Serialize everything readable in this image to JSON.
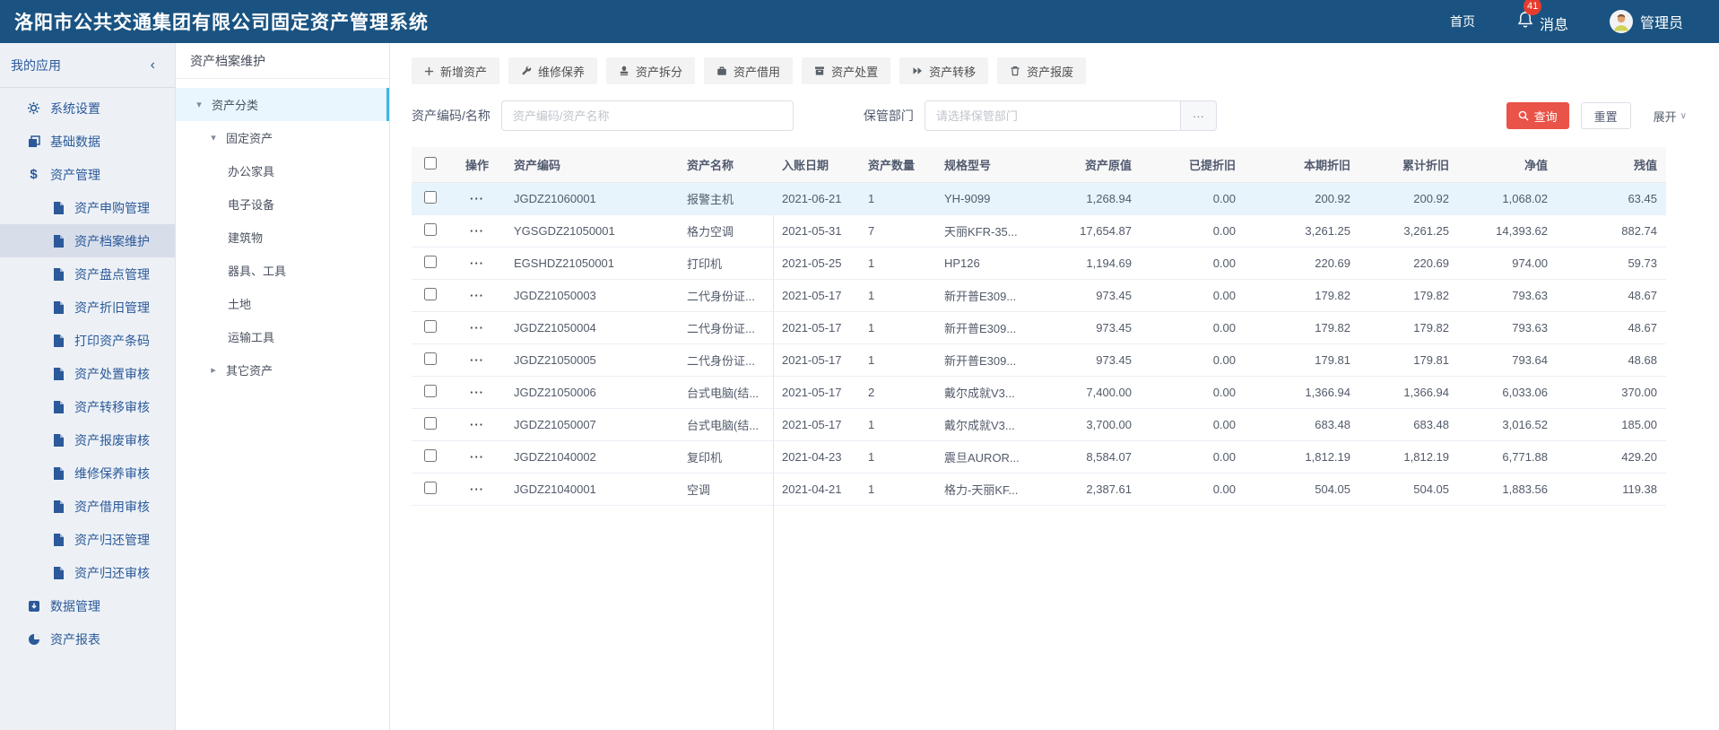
{
  "header": {
    "title": "洛阳市公共交通集团有限公司固定资产管理系统",
    "nav_home": "首页",
    "messages_label": "消息",
    "messages_count": "41",
    "user_label": "管理员"
  },
  "icons": {
    "caret_down": "▾",
    "caret_right": "▸",
    "collapse": "‹",
    "expand_caret": "∨",
    "plus": "+",
    "ellipsis": "···",
    "row_actions": "···"
  },
  "sidebar": {
    "header": "我的应用",
    "items": [
      {
        "label": "系统设置"
      },
      {
        "label": "基础数据"
      },
      {
        "label": "资产管理"
      },
      {
        "label": "资产申购管理"
      },
      {
        "label": "资产档案维护"
      },
      {
        "label": "资产盘点管理"
      },
      {
        "label": "资产折旧管理"
      },
      {
        "label": "打印资产条码"
      },
      {
        "label": "资产处置审核"
      },
      {
        "label": "资产转移审核"
      },
      {
        "label": "资产报废审核"
      },
      {
        "label": "维修保养审核"
      },
      {
        "label": "资产借用审核"
      },
      {
        "label": "资产归还管理"
      },
      {
        "label": "资产归还审核"
      },
      {
        "label": "数据管理"
      },
      {
        "label": "资产报表"
      }
    ]
  },
  "tree_panel": {
    "title": "资产档案维护",
    "nodes": [
      {
        "label": "资产分类"
      },
      {
        "label": "固定资产"
      },
      {
        "label": "办公家具"
      },
      {
        "label": "电子设备"
      },
      {
        "label": "建筑物"
      },
      {
        "label": "器具、工具"
      },
      {
        "label": "土地"
      },
      {
        "label": "运输工具"
      },
      {
        "label": "其它资产"
      }
    ]
  },
  "toolbar": {
    "buttons": [
      {
        "label": "新增资产"
      },
      {
        "label": "维修保养"
      },
      {
        "label": "资产拆分"
      },
      {
        "label": "资产借用"
      },
      {
        "label": "资产处置"
      },
      {
        "label": "资产转移"
      },
      {
        "label": "资产报废"
      }
    ]
  },
  "search": {
    "code_label": "资产编码/名称",
    "code_placeholder": "资产编码/资产名称",
    "dept_label": "保管部门",
    "dept_placeholder": "请选择保管部门",
    "query_button": "查询",
    "reset_button": "重置",
    "expand_label": "展开"
  },
  "table": {
    "columns": {
      "op": "操作",
      "code": "资产编码",
      "name": "资产名称",
      "date": "入账日期",
      "qty": "资产数量",
      "model": "规格型号",
      "orig": "资产原值",
      "provided": "已提折旧",
      "period": "本期折旧",
      "accum": "累计折旧",
      "net": "净值",
      "residual": "残值"
    },
    "rows": [
      {
        "code": "JGDZ21060001",
        "name": "报警主机",
        "date": "2021-06-21",
        "qty": "1",
        "model": "YH-9099",
        "orig": "1,268.94",
        "provided": "0.00",
        "period": "200.92",
        "accum": "200.92",
        "net": "1,068.02",
        "residual": "63.45"
      },
      {
        "code": "YGSGDZ21050001",
        "name": "格力空调",
        "date": "2021-05-31",
        "qty": "7",
        "model": "天丽KFR-35...",
        "orig": "17,654.87",
        "provided": "0.00",
        "period": "3,261.25",
        "accum": "3,261.25",
        "net": "14,393.62",
        "residual": "882.74"
      },
      {
        "code": "EGSHDZ21050001",
        "name": "打印机",
        "date": "2021-05-25",
        "qty": "1",
        "model": "HP126",
        "orig": "1,194.69",
        "provided": "0.00",
        "period": "220.69",
        "accum": "220.69",
        "net": "974.00",
        "residual": "59.73"
      },
      {
        "code": "JGDZ21050003",
        "name": "二代身份证...",
        "date": "2021-05-17",
        "qty": "1",
        "model": "新开普E309...",
        "orig": "973.45",
        "provided": "0.00",
        "period": "179.82",
        "accum": "179.82",
        "net": "793.63",
        "residual": "48.67"
      },
      {
        "code": "JGDZ21050004",
        "name": "二代身份证...",
        "date": "2021-05-17",
        "qty": "1",
        "model": "新开普E309...",
        "orig": "973.45",
        "provided": "0.00",
        "period": "179.82",
        "accum": "179.82",
        "net": "793.63",
        "residual": "48.67"
      },
      {
        "code": "JGDZ21050005",
        "name": "二代身份证...",
        "date": "2021-05-17",
        "qty": "1",
        "model": "新开普E309...",
        "orig": "973.45",
        "provided": "0.00",
        "period": "179.81",
        "accum": "179.81",
        "net": "793.64",
        "residual": "48.68"
      },
      {
        "code": "JGDZ21050006",
        "name": "台式电脑(结...",
        "date": "2021-05-17",
        "qty": "2",
        "model": "戴尔成就V3...",
        "orig": "7,400.00",
        "provided": "0.00",
        "period": "1,366.94",
        "accum": "1,366.94",
        "net": "6,033.06",
        "residual": "370.00"
      },
      {
        "code": "JGDZ21050007",
        "name": "台式电脑(结...",
        "date": "2021-05-17",
        "qty": "1",
        "model": "戴尔成就V3...",
        "orig": "3,700.00",
        "provided": "0.00",
        "period": "683.48",
        "accum": "683.48",
        "net": "3,016.52",
        "residual": "185.00"
      },
      {
        "code": "JGDZ21040002",
        "name": "复印机",
        "date": "2021-04-23",
        "qty": "1",
        "model": "震旦AUROR...",
        "orig": "8,584.07",
        "provided": "0.00",
        "period": "1,812.19",
        "accum": "1,812.19",
        "net": "6,771.88",
        "residual": "429.20"
      },
      {
        "code": "JGDZ21040001",
        "name": "空调",
        "date": "2021-04-21",
        "qty": "1",
        "model": "格力-天丽KF...",
        "orig": "2,387.61",
        "provided": "0.00",
        "period": "504.05",
        "accum": "504.05",
        "net": "1,883.56",
        "residual": "119.38"
      }
    ]
  },
  "colors": {
    "header_bg": "#1a5381",
    "badge_red": "#e63c2f",
    "query_red": "#ea5348",
    "sidebar_bg": "#edf1f6",
    "sidebar_active_bg": "#d7deea",
    "tree_active_bg": "#e9f6fd",
    "tree_active_bar": "#41b3ec",
    "row_selected_bg": "#e7f4fc",
    "table_header_bg": "#f8f8f9"
  }
}
